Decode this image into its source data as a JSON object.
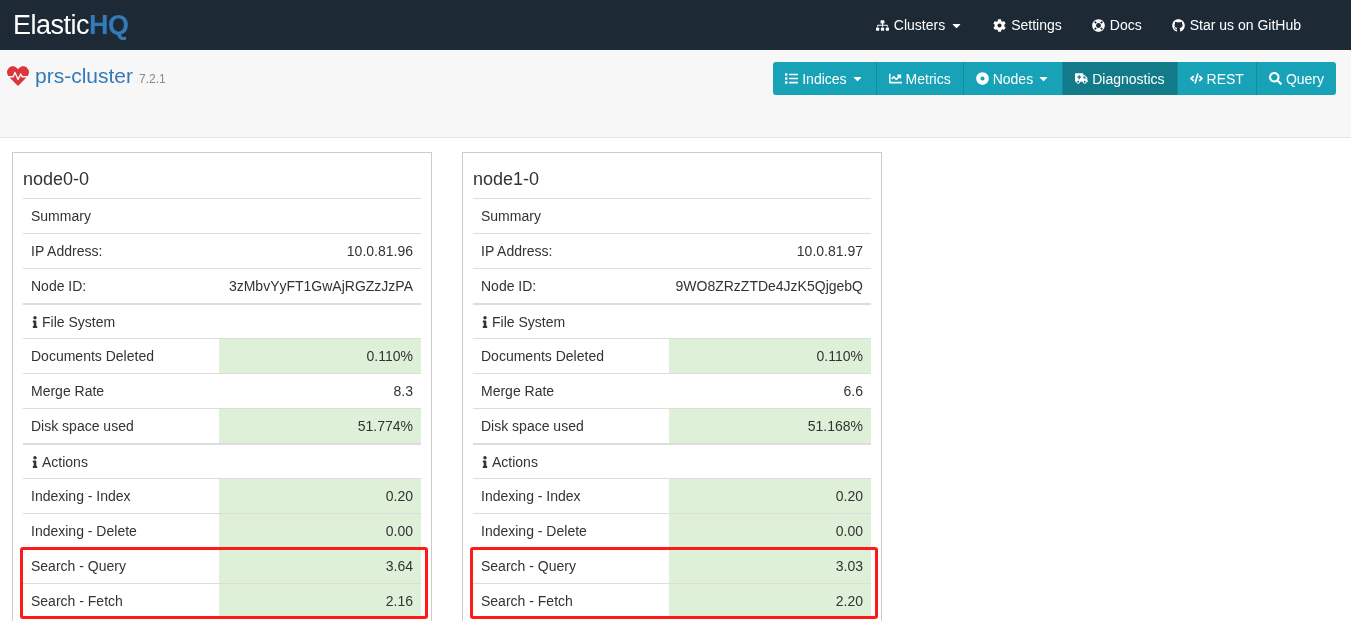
{
  "brand": {
    "text": "Elastic",
    "accent": "HQ"
  },
  "top_nav": [
    {
      "label": "Clusters",
      "dropdown": true
    },
    {
      "label": "Settings",
      "dropdown": false
    },
    {
      "label": "Docs",
      "dropdown": false
    },
    {
      "label": "Star us on GitHub",
      "dropdown": false
    }
  ],
  "cluster": {
    "name": "prs-cluster",
    "version": "7.2.1"
  },
  "toolbar": [
    {
      "label": "Indices",
      "dropdown": true,
      "selected": false
    },
    {
      "label": "Metrics",
      "dropdown": false,
      "selected": false
    },
    {
      "label": "Nodes",
      "dropdown": true,
      "selected": false
    },
    {
      "label": "Diagnostics",
      "dropdown": false,
      "selected": true
    },
    {
      "label": "REST",
      "dropdown": false,
      "selected": false
    },
    {
      "label": "Query",
      "dropdown": false,
      "selected": false
    }
  ],
  "nodes": [
    {
      "name": "node0-0",
      "rows": [
        {
          "kind": "heading",
          "label": "Summary"
        },
        {
          "kind": "metric",
          "label": "IP Address:",
          "value": "10.0.81.96",
          "highlighted": false,
          "annotated": false
        },
        {
          "kind": "metric",
          "label": "Node ID:",
          "value": "3zMbvYyFT1GwAjRGZzJzPA",
          "highlighted": false,
          "annotated": false
        },
        {
          "kind": "info_heading",
          "label": "File System"
        },
        {
          "kind": "metric",
          "label": "Documents Deleted",
          "value": "0.110%",
          "highlighted": true,
          "annotated": false
        },
        {
          "kind": "metric",
          "label": "Merge Rate",
          "value": "8.3",
          "highlighted": false,
          "annotated": false
        },
        {
          "kind": "metric",
          "label": "Disk space used",
          "value": "51.774%",
          "highlighted": true,
          "annotated": false
        },
        {
          "kind": "info_heading",
          "label": "Actions"
        },
        {
          "kind": "metric",
          "label": "Indexing - Index",
          "value": "0.20",
          "highlighted": true,
          "annotated": false
        },
        {
          "kind": "metric",
          "label": "Indexing - Delete",
          "value": "0.00",
          "highlighted": true,
          "annotated": false
        },
        {
          "kind": "metric",
          "label": "Search - Query",
          "value": "3.64",
          "highlighted": true,
          "annotated": true
        },
        {
          "kind": "metric",
          "label": "Search - Fetch",
          "value": "2.16",
          "highlighted": true,
          "annotated": true
        }
      ]
    },
    {
      "name": "node1-0",
      "rows": [
        {
          "kind": "heading",
          "label": "Summary"
        },
        {
          "kind": "metric",
          "label": "IP Address:",
          "value": "10.0.81.97",
          "highlighted": false,
          "annotated": false
        },
        {
          "kind": "metric",
          "label": "Node ID:",
          "value": "9WO8ZRzZTDe4JzK5QjgebQ",
          "highlighted": false,
          "annotated": false
        },
        {
          "kind": "info_heading",
          "label": "File System"
        },
        {
          "kind": "metric",
          "label": "Documents Deleted",
          "value": "0.110%",
          "highlighted": true,
          "annotated": false
        },
        {
          "kind": "metric",
          "label": "Merge Rate",
          "value": "6.6",
          "highlighted": false,
          "annotated": false
        },
        {
          "kind": "metric",
          "label": "Disk space used",
          "value": "51.168%",
          "highlighted": true,
          "annotated": false
        },
        {
          "kind": "info_heading",
          "label": "Actions"
        },
        {
          "kind": "metric",
          "label": "Indexing - Index",
          "value": "0.20",
          "highlighted": true,
          "annotated": false
        },
        {
          "kind": "metric",
          "label": "Indexing - Delete",
          "value": "0.00",
          "highlighted": true,
          "annotated": false
        },
        {
          "kind": "metric",
          "label": "Search - Query",
          "value": "3.03",
          "highlighted": true,
          "annotated": true
        },
        {
          "kind": "metric",
          "label": "Search - Fetch",
          "value": "2.20",
          "highlighted": true,
          "annotated": true
        }
      ]
    }
  ]
}
